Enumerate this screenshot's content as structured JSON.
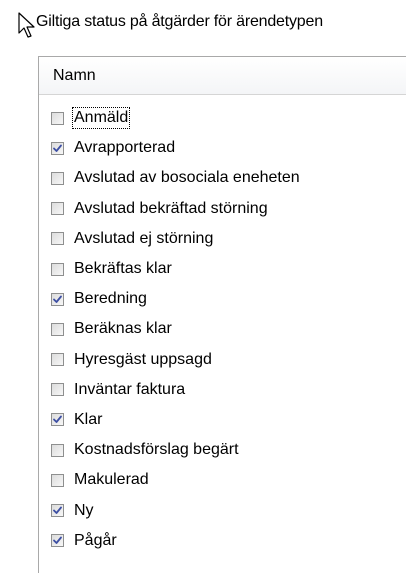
{
  "group": {
    "title": "Giltiga status på åtgärder för ärendetypen"
  },
  "list": {
    "column_header": "Namn",
    "items": [
      {
        "label": "Anmäld",
        "checked": false,
        "focused": true
      },
      {
        "label": "Avrapporterad",
        "checked": true,
        "focused": false
      },
      {
        "label": "Avslutad av bosociala eneheten",
        "checked": false,
        "focused": false
      },
      {
        "label": "Avslutad bekräftad störning",
        "checked": false,
        "focused": false
      },
      {
        "label": "Avslutad ej störning",
        "checked": false,
        "focused": false
      },
      {
        "label": "Bekräftas klar",
        "checked": false,
        "focused": false
      },
      {
        "label": "Beredning",
        "checked": true,
        "focused": false
      },
      {
        "label": "Beräknas klar",
        "checked": false,
        "focused": false
      },
      {
        "label": "Hyresgäst uppsagd",
        "checked": false,
        "focused": false
      },
      {
        "label": "Inväntar faktura",
        "checked": false,
        "focused": false
      },
      {
        "label": "Klar",
        "checked": true,
        "focused": false
      },
      {
        "label": "Kostnadsförslag begärt",
        "checked": false,
        "focused": false
      },
      {
        "label": "Makulerad",
        "checked": false,
        "focused": false
      },
      {
        "label": "Ny",
        "checked": true,
        "focused": false
      },
      {
        "label": "Pågår",
        "checked": true,
        "focused": false
      }
    ]
  },
  "colors": {
    "check_mark": "#3d4fa3",
    "checkbox_border": "#8e8f8f",
    "panel_border": "#a9a9a9"
  },
  "icons": {
    "cursor": "mouse-pointer-icon",
    "check": "check-icon"
  }
}
